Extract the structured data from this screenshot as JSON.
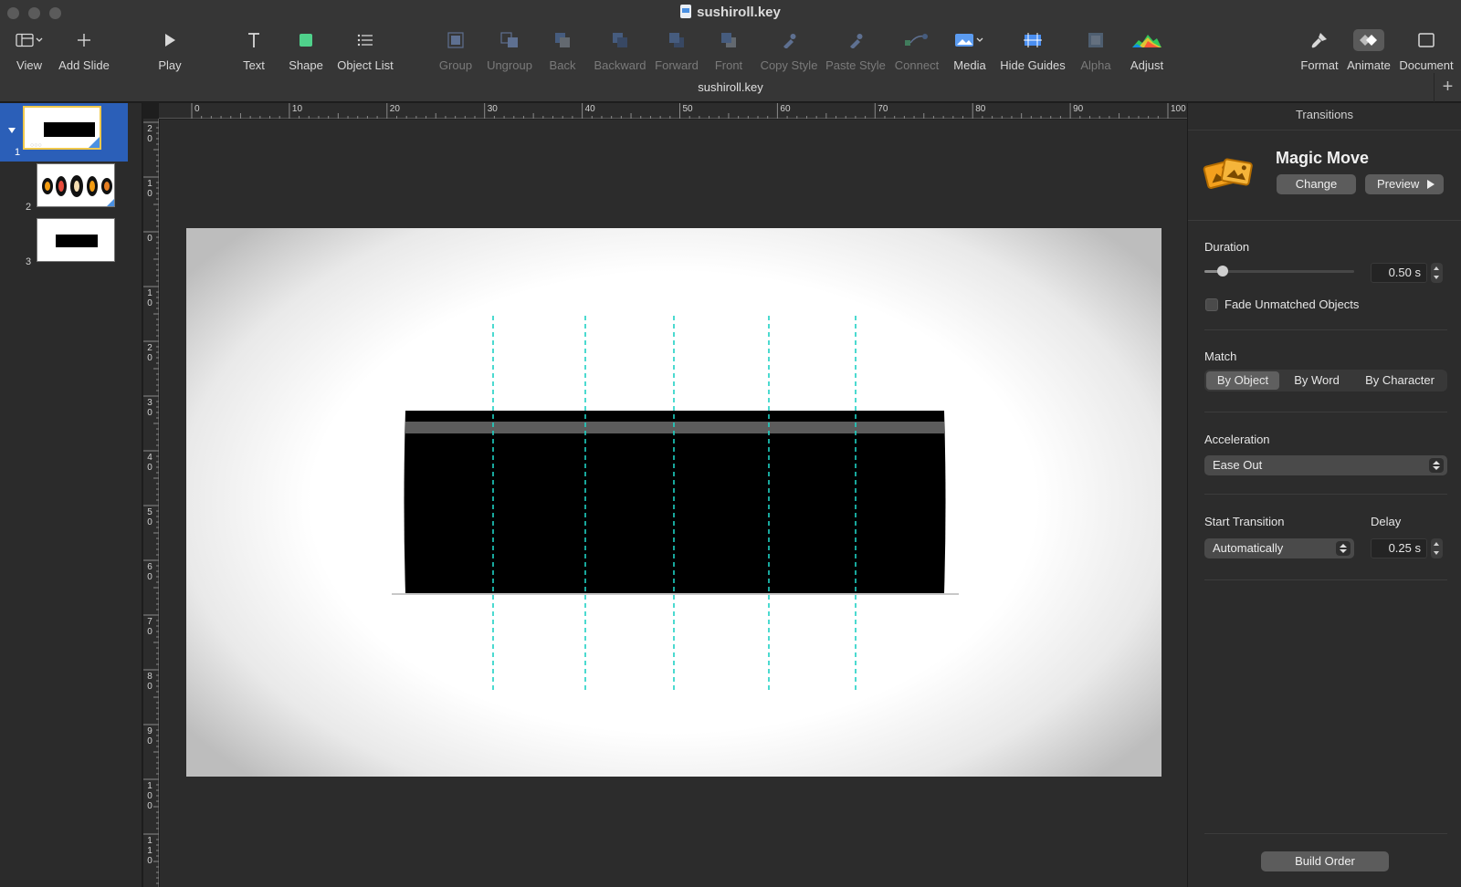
{
  "window": {
    "title": "sushiroll.key",
    "tab_title": "sushiroll.key"
  },
  "toolbar": {
    "items": [
      {
        "label": "View",
        "icon": "view-sidebar-icon",
        "enabled": true
      },
      {
        "label": "Add Slide",
        "icon": "plus-icon",
        "enabled": true
      },
      {
        "label": "Play",
        "icon": "play-icon",
        "enabled": true
      },
      {
        "label": "Text",
        "icon": "text-icon",
        "enabled": true
      },
      {
        "label": "Shape",
        "icon": "shape-icon",
        "enabled": true
      },
      {
        "label": "Object List",
        "icon": "list-icon",
        "enabled": true
      },
      {
        "label": "Group",
        "icon": "group-icon",
        "enabled": false
      },
      {
        "label": "Ungroup",
        "icon": "ungroup-icon",
        "enabled": false
      },
      {
        "label": "Back",
        "icon": "back-icon",
        "enabled": false
      },
      {
        "label": "Backward",
        "icon": "backward-icon",
        "enabled": false
      },
      {
        "label": "Forward",
        "icon": "forward-icon",
        "enabled": false
      },
      {
        "label": "Front",
        "icon": "front-icon",
        "enabled": false
      },
      {
        "label": "Copy Style",
        "icon": "eyedropper-icon",
        "enabled": false
      },
      {
        "label": "Paste Style",
        "icon": "paste-style-icon",
        "enabled": false
      },
      {
        "label": "Connect",
        "icon": "connect-icon",
        "enabled": false
      },
      {
        "label": "Media",
        "icon": "media-icon",
        "enabled": true
      },
      {
        "label": "Hide Guides",
        "icon": "guides-icon",
        "enabled": true
      },
      {
        "label": "Alpha",
        "icon": "alpha-icon",
        "enabled": false
      },
      {
        "label": "Adjust",
        "icon": "adjust-icon",
        "enabled": true
      },
      {
        "label": "Format",
        "icon": "paintbrush-icon",
        "enabled": true
      },
      {
        "label": "Animate",
        "icon": "animate-diamond-icon",
        "enabled": true
      },
      {
        "label": "Document",
        "icon": "document-icon",
        "enabled": true
      }
    ]
  },
  "navigator": {
    "slides": [
      {
        "number": "1",
        "selected": true
      },
      {
        "number": "2",
        "selected": false
      },
      {
        "number": "3",
        "selected": false
      }
    ]
  },
  "rulers": {
    "horizontal": [
      "0",
      "10",
      "20",
      "30",
      "40",
      "50",
      "60",
      "70",
      "80",
      "90",
      "100"
    ],
    "vertical": [
      "20",
      "10",
      "0",
      "10",
      "20",
      "30",
      "40",
      "50",
      "60",
      "70",
      "80",
      "90",
      "100",
      "110"
    ]
  },
  "inspector": {
    "tab": "Transitions",
    "transition": {
      "name": "Magic Move",
      "change_label": "Change",
      "preview_label": "Preview"
    },
    "duration": {
      "title": "Duration",
      "value": "0.50 s",
      "slider_fraction": 0.12
    },
    "fade_unmatched": {
      "label": "Fade Unmatched Objects",
      "checked": false
    },
    "match": {
      "title": "Match",
      "options": [
        "By Object",
        "By Word",
        "By Character"
      ],
      "selected": "By Object"
    },
    "acceleration": {
      "title": "Acceleration",
      "value": "Ease Out"
    },
    "start_transition": {
      "title": "Start Transition",
      "value": "Automatically"
    },
    "delay": {
      "title": "Delay",
      "value": "0.25 s"
    },
    "build_order_label": "Build Order"
  },
  "colors": {
    "selection_blue": "#2b5fb8",
    "guide_cyan": "#1fd1c4",
    "magic_move_orange": "#f3a01d"
  }
}
